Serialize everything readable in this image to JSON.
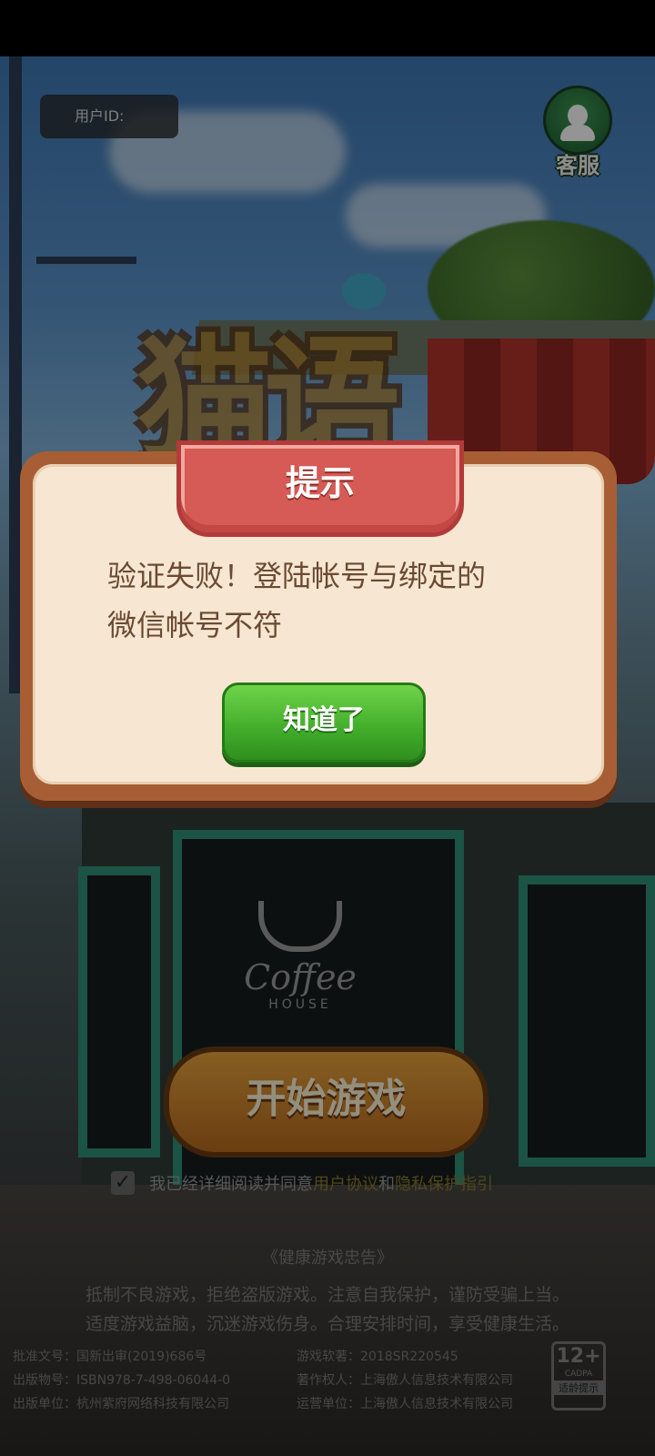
{
  "header": {
    "user_id_label": "用户ID:",
    "service_label": "客服"
  },
  "logo": {
    "title": "猫语"
  },
  "scene": {
    "sign_word": "Coffee",
    "sign_sub": "HOUSE"
  },
  "start_button": {
    "label": "开始游戏"
  },
  "agreement": {
    "checked": true,
    "prefix": "我已经详细阅读并同意",
    "user_agreement": "用户协议",
    "and": "和",
    "privacy_guide": "隐私保护指引"
  },
  "health_notice": {
    "title": "《健康游戏忠告》",
    "line1": "抵制不良游戏，拒绝盗版游戏。注意自我保护，谨防受骗上当。",
    "line2": "适度游戏益脑，沉迷游戏伤身。合理安排时间，享受健康生活。"
  },
  "footer": {
    "approval": "批准文号：国新出审(2019)686号",
    "isbn": "出版物号：ISBN978-7-498-06044-0",
    "publisher": "出版单位：杭州紫府网络科技有限公司",
    "software": "游戏软著：2018SR220545",
    "copyright": "著作权人：上海傲人信息技术有限公司",
    "operator": "运营单位：上海傲人信息技术有限公司"
  },
  "age_rating": {
    "age": "12+",
    "org": "CADPA",
    "tip": "适龄提示"
  },
  "dialog": {
    "title": "提示",
    "message_line1": "验证失败！登陆帐号与绑定的",
    "message_line2": "微信帐号不符",
    "confirm_label": "知道了"
  },
  "colors": {
    "dialog_bg": "#f7e7d2",
    "dialog_border": "#a85e34",
    "ribbon": "#d65a55",
    "confirm_button": "#41ac2a",
    "message_text": "#6b4a33"
  }
}
